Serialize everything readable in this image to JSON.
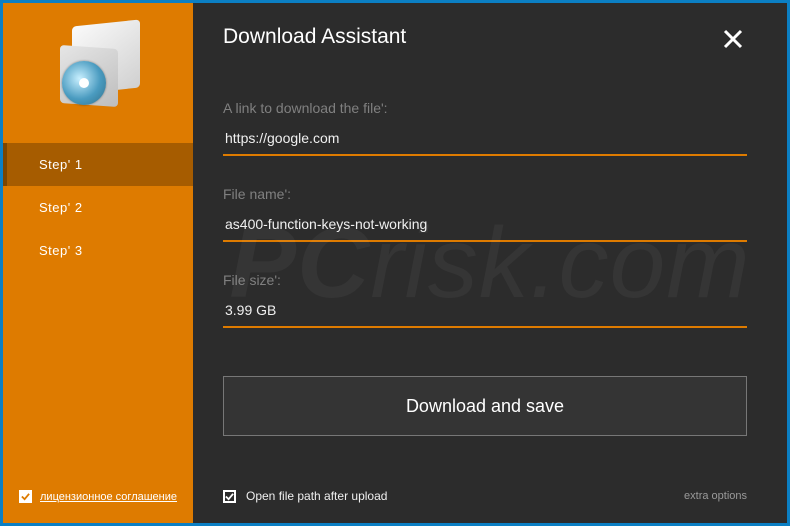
{
  "title": "Download Assistant",
  "sidebar": {
    "steps": [
      {
        "label": "Step' 1"
      },
      {
        "label": "Step' 2"
      },
      {
        "label": "Step' 3"
      }
    ],
    "active_step_index": 0,
    "license_checked": true,
    "license_label": "лицензионное соглашение"
  },
  "fields": {
    "link_label": "A link to download the file':",
    "link_value": "https://google.com",
    "filename_label": "File name':",
    "filename_value": "as400-function-keys-not-working",
    "filesize_label": "File size':",
    "filesize_value": "3.99 GB"
  },
  "download_button": "Download and save",
  "footer": {
    "open_path_checked": true,
    "open_path_label": "Open file path after upload",
    "extra_options": "extra options"
  },
  "watermark_prefix": "PC",
  "watermark_suffix": "risk.com",
  "colors": {
    "accent_orange": "#de7b00",
    "border_blue": "#0b7fc4"
  }
}
